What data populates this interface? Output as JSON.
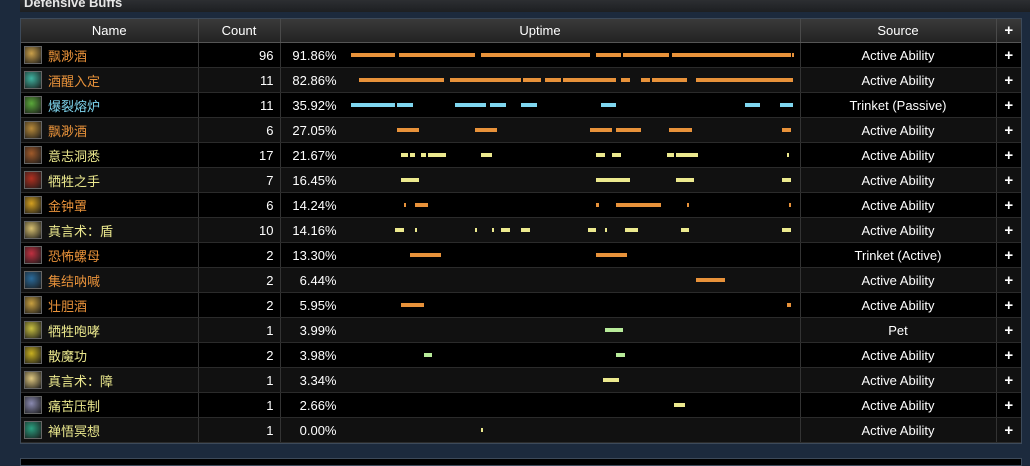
{
  "panel": {
    "title": "Defensive Buffs"
  },
  "columns": {
    "name": "Name",
    "count": "Count",
    "uptime": "Uptime",
    "source": "Source",
    "expand": "+"
  },
  "colors": {
    "orange": "#e8923a",
    "cyan": "#7fd6ef",
    "yellow": "#ece98e",
    "green": "#b8eb9a"
  },
  "rows": [
    {
      "name": "飘渺酒",
      "name_color": "#e8923a",
      "icon": "brew-barrel-icon",
      "icon_color": "#caa04a",
      "count": "96",
      "uptime": "91.86%",
      "source": "Active Ability",
      "expand": "+",
      "bar_color": "#e8923a",
      "segments": [
        [
          0.0,
          0.1
        ],
        [
          0.11,
          0.28
        ],
        [
          0.295,
          0.54
        ],
        [
          0.555,
          0.61
        ],
        [
          0.615,
          0.72
        ],
        [
          0.725,
          0.995
        ],
        [
          0.997,
          1.0
        ]
      ]
    },
    {
      "name": "酒醒入定",
      "name_color": "#e8923a",
      "icon": "mist-swirl-icon",
      "icon_color": "#3fb3a0",
      "count": "11",
      "uptime": "82.86%",
      "source": "Active Ability",
      "expand": "+",
      "bar_color": "#e8923a",
      "segments": [
        [
          0.02,
          0.21
        ],
        [
          0.225,
          0.385
        ],
        [
          0.39,
          0.43
        ],
        [
          0.44,
          0.475
        ],
        [
          0.48,
          0.6
        ],
        [
          0.61,
          0.63
        ],
        [
          0.655,
          0.675
        ],
        [
          0.68,
          0.76
        ],
        [
          0.78,
          1.0
        ]
      ]
    },
    {
      "name": "爆裂熔炉",
      "name_color": "#7fd6ef",
      "icon": "furnace-icon",
      "icon_color": "#5aa83a",
      "count": "11",
      "uptime": "35.92%",
      "source": "Trinket (Passive)",
      "expand": "+",
      "bar_color": "#7fd6ef",
      "segments": [
        [
          0.0,
          0.1
        ],
        [
          0.105,
          0.14
        ],
        [
          0.235,
          0.305
        ],
        [
          0.315,
          0.35
        ],
        [
          0.385,
          0.42
        ],
        [
          0.565,
          0.6
        ],
        [
          0.89,
          0.925
        ],
        [
          0.97,
          1.0
        ]
      ]
    },
    {
      "name": "飘渺酒",
      "name_color": "#e8923a",
      "icon": "brew-barrel-icon",
      "icon_color": "#b88a3a",
      "count": "6",
      "uptime": "27.05%",
      "source": "Active Ability",
      "expand": "+",
      "bar_color": "#e8923a",
      "segments": [
        [
          0.105,
          0.155
        ],
        [
          0.28,
          0.33
        ],
        [
          0.54,
          0.59
        ],
        [
          0.6,
          0.655
        ],
        [
          0.72,
          0.77
        ],
        [
          0.975,
          0.995
        ]
      ]
    },
    {
      "name": "意志洞悉",
      "name_color": "#ece98e",
      "icon": "insight-eye-icon",
      "icon_color": "#a05a2a",
      "count": "17",
      "uptime": "21.67%",
      "source": "Active Ability",
      "expand": "+",
      "bar_color": "#ece98e",
      "segments": [
        [
          0.115,
          0.13
        ],
        [
          0.135,
          0.145
        ],
        [
          0.16,
          0.17
        ],
        [
          0.175,
          0.215
        ],
        [
          0.295,
          0.32
        ],
        [
          0.555,
          0.575
        ],
        [
          0.59,
          0.6
        ],
        [
          0.6,
          0.61
        ],
        [
          0.715,
          0.73
        ],
        [
          0.735,
          0.785
        ],
        [
          0.985,
          0.99
        ]
      ]
    },
    {
      "name": "牺牲之手",
      "name_color": "#ece98e",
      "icon": "hand-of-sacrifice-icon",
      "icon_color": "#b03020",
      "count": "7",
      "uptime": "16.45%",
      "source": "Active Ability",
      "expand": "+",
      "bar_color": "#ece98e",
      "segments": [
        [
          0.115,
          0.155
        ],
        [
          0.555,
          0.63
        ],
        [
          0.735,
          0.775
        ],
        [
          0.975,
          0.995
        ]
      ]
    },
    {
      "name": "金钟罩",
      "name_color": "#e8923a",
      "icon": "golden-bell-icon",
      "icon_color": "#d4a020",
      "count": "6",
      "uptime": "14.24%",
      "source": "Active Ability",
      "expand": "+",
      "bar_color": "#e8923a",
      "segments": [
        [
          0.12,
          0.125
        ],
        [
          0.145,
          0.175
        ],
        [
          0.555,
          0.56
        ],
        [
          0.6,
          0.7
        ],
        [
          0.76,
          0.765
        ],
        [
          0.99,
          0.995
        ]
      ]
    },
    {
      "name": "真言术：盾",
      "name_color": "#ece98e",
      "icon": "power-word-shield-icon",
      "icon_color": "#d8c070",
      "count": "10",
      "uptime": "14.16%",
      "source": "Active Ability",
      "expand": "+",
      "bar_color": "#ece98e",
      "segments": [
        [
          0.1,
          0.12
        ],
        [
          0.145,
          0.15
        ],
        [
          0.28,
          0.285
        ],
        [
          0.32,
          0.325
        ],
        [
          0.34,
          0.36
        ],
        [
          0.385,
          0.405
        ],
        [
          0.535,
          0.555
        ],
        [
          0.575,
          0.58
        ],
        [
          0.62,
          0.65
        ],
        [
          0.745,
          0.765
        ],
        [
          0.975,
          0.995
        ]
      ]
    },
    {
      "name": "恐怖螺母",
      "name_color": "#e8923a",
      "icon": "dread-nut-icon",
      "icon_color": "#c03040",
      "count": "2",
      "uptime": "13.30%",
      "source": "Trinket (Active)",
      "expand": "+",
      "bar_color": "#e8923a",
      "segments": [
        [
          0.135,
          0.205
        ],
        [
          0.555,
          0.625
        ]
      ]
    },
    {
      "name": "集结呐喊",
      "name_color": "#e8923a",
      "icon": "rallying-cry-icon",
      "icon_color": "#2a6a9a",
      "count": "2",
      "uptime": "6.44%",
      "source": "Active Ability",
      "expand": "+",
      "bar_color": "#e8923a",
      "segments": [
        [
          0.78,
          0.845
        ]
      ]
    },
    {
      "name": "壮胆酒",
      "name_color": "#e8923a",
      "icon": "fortifying-brew-icon",
      "icon_color": "#c8a040",
      "count": "2",
      "uptime": "5.95%",
      "source": "Active Ability",
      "expand": "+",
      "bar_color": "#e8923a",
      "segments": [
        [
          0.115,
          0.165
        ],
        [
          0.985,
          0.995
        ]
      ]
    },
    {
      "name": "牺牲咆哮",
      "name_color": "#ece98e",
      "icon": "roar-of-sacrifice-icon",
      "icon_color": "#c8c040",
      "count": "1",
      "uptime": "3.99%",
      "source": "Pet",
      "expand": "+",
      "bar_color": "#b8eb9a",
      "segments": [
        [
          0.575,
          0.615
        ]
      ]
    },
    {
      "name": "散魔功",
      "name_color": "#ece98e",
      "icon": "diffuse-magic-icon",
      "icon_color": "#c8b020",
      "count": "2",
      "uptime": "3.98%",
      "source": "Active Ability",
      "expand": "+",
      "bar_color": "#b8eb9a",
      "segments": [
        [
          0.165,
          0.185
        ],
        [
          0.6,
          0.62
        ]
      ]
    },
    {
      "name": "真言术：障",
      "name_color": "#ece98e",
      "icon": "power-word-barrier-icon",
      "icon_color": "#e0c880",
      "count": "1",
      "uptime": "3.34%",
      "source": "Active Ability",
      "expand": "+",
      "bar_color": "#ece98e",
      "segments": [
        [
          0.57,
          0.605
        ]
      ]
    },
    {
      "name": "痛苦压制",
      "name_color": "#ece98e",
      "icon": "pain-suppression-icon",
      "icon_color": "#8a8ab0",
      "count": "1",
      "uptime": "2.66%",
      "source": "Active Ability",
      "expand": "+",
      "bar_color": "#ece98e",
      "segments": [
        [
          0.73,
          0.755
        ]
      ]
    },
    {
      "name": "禅悟冥想",
      "name_color": "#ece98e",
      "icon": "zen-meditation-icon",
      "icon_color": "#2aa080",
      "count": "1",
      "uptime": "0.00%",
      "source": "Active Ability",
      "expand": "+",
      "bar_color": "#ece98e",
      "segments": [
        [
          0.295,
          0.298
        ]
      ]
    }
  ]
}
